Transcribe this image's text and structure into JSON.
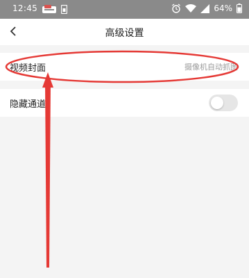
{
  "status_bar": {
    "time": "12:45",
    "battery": "64%",
    "icons": [
      "notification-icon",
      "sim-icon",
      "alarm-icon",
      "wifi-icon",
      "signal-icon",
      "battery-icon"
    ]
  },
  "nav": {
    "title": "高级设置",
    "back_icon": "chevron-left-icon"
  },
  "settings": {
    "video_cover": {
      "label": "视频封面",
      "value": "摄像机自动抓图"
    },
    "hide_channel": {
      "label": "隐藏通道",
      "enabled": false
    }
  },
  "annotation": {
    "color": "#e53935"
  }
}
